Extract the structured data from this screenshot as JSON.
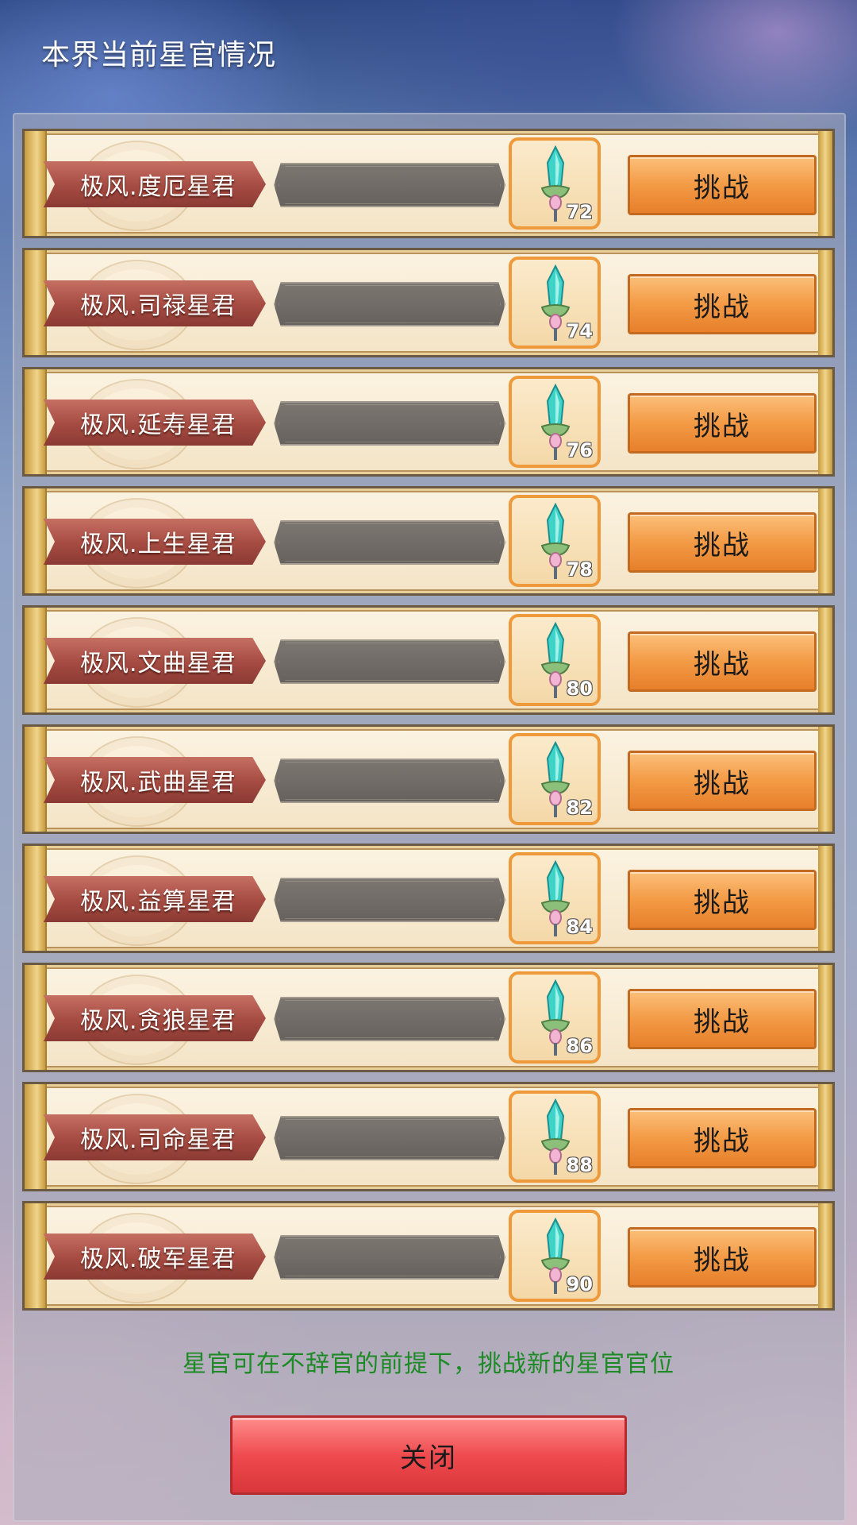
{
  "header": {
    "title": "本界当前星官情况"
  },
  "stars": [
    {
      "name": "极风.度厄星君",
      "level": "72",
      "action": "挑战"
    },
    {
      "name": "极风.司禄星君",
      "level": "74",
      "action": "挑战"
    },
    {
      "name": "极风.延寿星君",
      "level": "76",
      "action": "挑战"
    },
    {
      "name": "极风.上生星君",
      "level": "78",
      "action": "挑战"
    },
    {
      "name": "极风.文曲星君",
      "level": "80",
      "action": "挑战"
    },
    {
      "name": "极风.武曲星君",
      "level": "82",
      "action": "挑战"
    },
    {
      "name": "极风.益算星君",
      "level": "84",
      "action": "挑战"
    },
    {
      "name": "极风.贪狼星君",
      "level": "86",
      "action": "挑战"
    },
    {
      "name": "极风.司命星君",
      "level": "88",
      "action": "挑战"
    },
    {
      "name": "极风.破军星君",
      "level": "90",
      "action": "挑战"
    }
  ],
  "hint": "星官可在不辞官的前提下，挑战新的星官官位",
  "close_label": "关闭",
  "icons": {
    "level_badge": "crystal-sword-icon"
  },
  "colors": {
    "challenge_button": "#f39a45",
    "close_button": "#ef4b4f",
    "hint_text": "#1d8a25"
  }
}
